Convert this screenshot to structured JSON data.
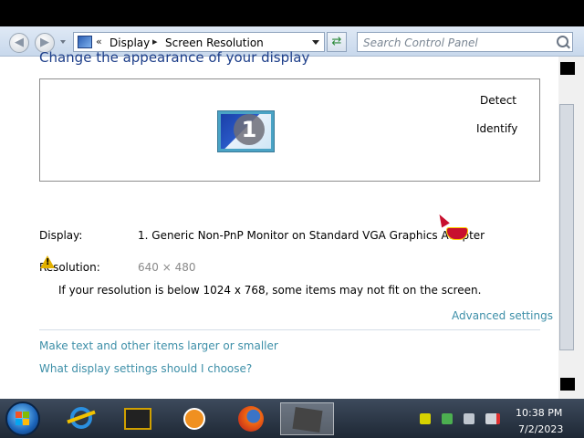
{
  "window": {
    "back_label": "◀",
    "forward_label": "▶",
    "breadcrumb": [
      "«",
      "Display",
      "▸",
      "Screen Resolution"
    ],
    "refresh_label": "⇄",
    "search_placeholder": "Search Control Panel"
  },
  "page": {
    "heading": "Change the appearance of your display",
    "detect_label": "Detect",
    "identify_label": "Identify",
    "monitor_number": "1",
    "display_label": "Display:",
    "display_value": "1. Generic Non-PnP Monitor on Standard VGA Graphics Adapter",
    "resolution_label": "Resolution:",
    "resolution_value": "640 × 480",
    "warning_glyph": "!",
    "warning_text": "If your resolution is below 1024 x 768, some items may not fit on the screen.",
    "advanced_link": "Advanced settings",
    "link_text_size": "Make text and other items larger or smaller",
    "link_choose": "What display settings should I choose?"
  },
  "taskbar": {
    "apps": [
      "start-button",
      "internet-explorer-icon",
      "media-app-icon",
      "media-player-icon",
      "firefox-icon",
      "active-window-icon"
    ],
    "time": "10:38 PM",
    "date": "7/2/2023"
  },
  "colors": {
    "heading": "#1e3f8a",
    "link": "#3d8fa8",
    "taskbar": "#1e2835"
  }
}
